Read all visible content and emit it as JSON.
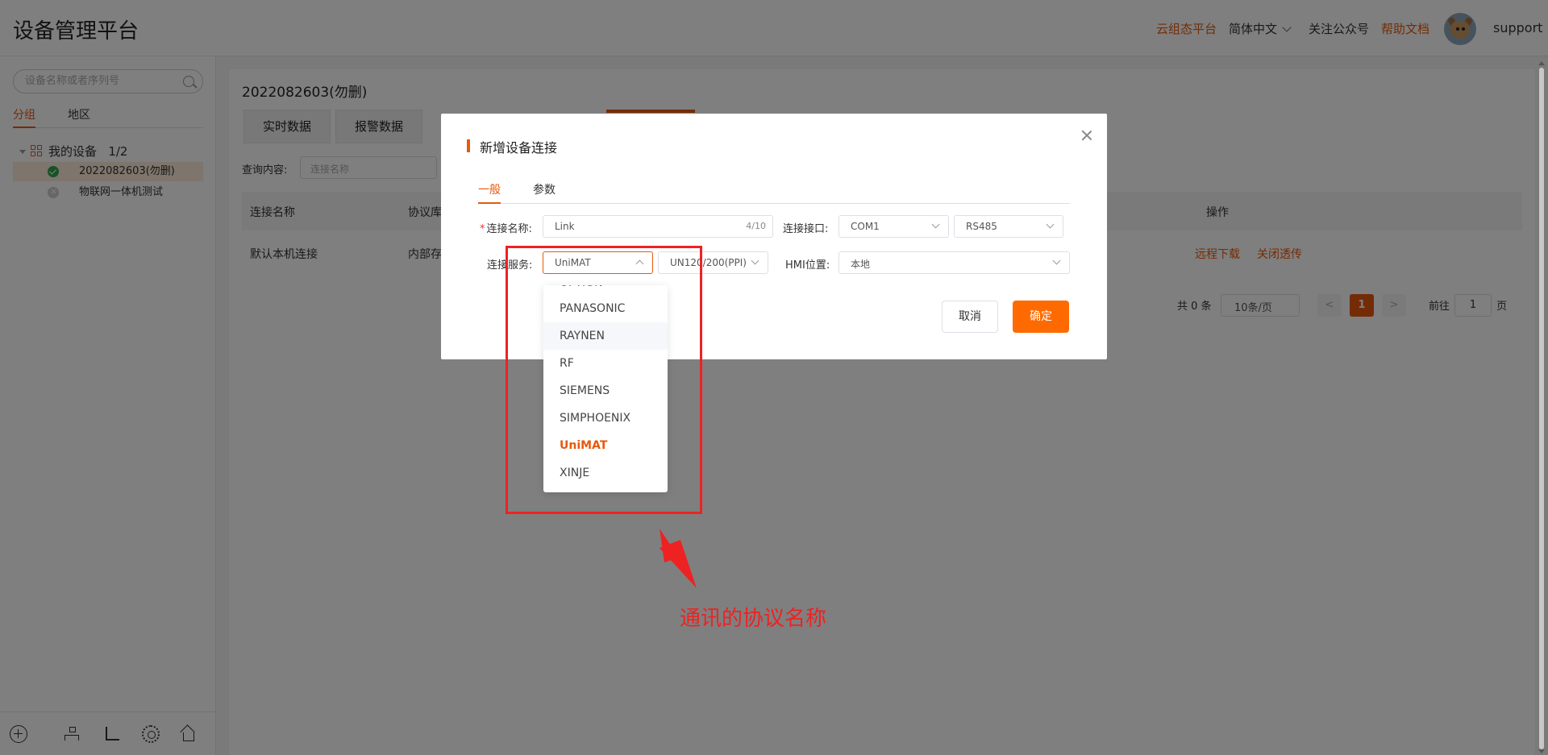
{
  "header": {
    "app_title": "设备管理平台",
    "links": {
      "cloud": "云组态平台",
      "language": "简体中文",
      "follow": "关注公众号",
      "help": "帮助文档"
    },
    "username": "support"
  },
  "sidebar": {
    "search_placeholder": "设备名称或者序列号",
    "tabs": [
      "分组",
      "地区"
    ],
    "tree": {
      "root_label": "我的设备",
      "root_count": "1/2",
      "nodes": [
        {
          "label": "2022082603(勿删)",
          "status": "online"
        },
        {
          "label": "物联网一体机测试",
          "status": "offline"
        }
      ]
    }
  },
  "main": {
    "device_title": "2022082603(勿删)",
    "tabs": [
      "实时数据",
      "报警数据"
    ],
    "query_label": "查询内容:",
    "query_placeholder": "连接名称",
    "columns": [
      "连接名称",
      "协议库",
      "操作"
    ],
    "rows": [
      {
        "name": "默认本机连接",
        "protocol": "内部存",
        "actions": [
          "远程下载",
          "关闭透传"
        ]
      }
    ],
    "pager": {
      "total": "共 0 条",
      "page_size": "10条/页",
      "prev": "<",
      "current": "1",
      "next": ">",
      "goto_label": "前往",
      "goto_value": "1",
      "page_suffix": "页"
    }
  },
  "dialog": {
    "title": "新增设备连接",
    "tabs": [
      "一般",
      "参数"
    ],
    "fields": {
      "name_label": "连接名称:",
      "name_value": "Link",
      "name_count": "4/10",
      "port_label": "连接接口:",
      "port_value": "COM1",
      "port_type": "RS485",
      "service_label": "连接服务:",
      "service_value": "UniMAT",
      "model_value": "UN120/200(PPI)",
      "hmi_label": "HMI位置:",
      "hmi_value": "本地"
    },
    "buttons": {
      "cancel": "取消",
      "ok": "确定"
    },
    "dropdown": {
      "partial": "OPTION",
      "options": [
        "PANASONIC",
        "RAYNEN",
        "RF",
        "SIEMENS",
        "SIMPHOENIX",
        "UniMAT",
        "XINJE"
      ],
      "hover": "RAYNEN",
      "selected": "UniMAT"
    }
  },
  "annotation": {
    "text": "通讯的协议名称",
    "color": "#ee2222"
  },
  "colors": {
    "accent": "#e8590c",
    "button_primary": "#ff6a00"
  }
}
